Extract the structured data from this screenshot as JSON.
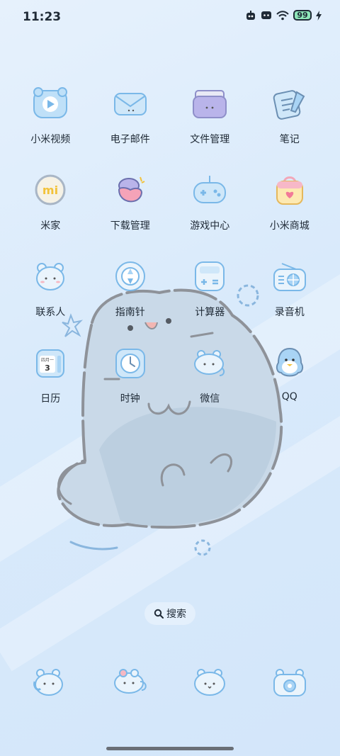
{
  "status_bar": {
    "time": "11:23",
    "battery": "99"
  },
  "apps": [
    [
      {
        "label": "小米视频",
        "icon": "video-icon"
      },
      {
        "label": "电子邮件",
        "icon": "mail-icon"
      },
      {
        "label": "文件管理",
        "icon": "folder-icon"
      },
      {
        "label": "笔记",
        "icon": "notes-icon"
      }
    ],
    [
      {
        "label": "米家",
        "icon": "mijia-icon"
      },
      {
        "label": "下载管理",
        "icon": "download-icon"
      },
      {
        "label": "游戏中心",
        "icon": "gamepad-icon"
      },
      {
        "label": "小米商城",
        "icon": "shop-icon"
      }
    ],
    [
      {
        "label": "联系人",
        "icon": "contacts-icon"
      },
      {
        "label": "指南针",
        "icon": "compass-icon"
      },
      {
        "label": "计算器",
        "icon": "calculator-icon"
      },
      {
        "label": "录音机",
        "icon": "recorder-icon"
      }
    ],
    [
      {
        "label": "日历",
        "icon": "calendar-icon"
      },
      {
        "label": "时钟",
        "icon": "clock-icon"
      },
      {
        "label": "微信",
        "icon": "wechat-icon"
      },
      {
        "label": "QQ",
        "icon": "qq-icon"
      }
    ]
  ],
  "calendar_icon_text": {
    "header": "四月一",
    "day": "3"
  },
  "mijia_icon_text": "mi",
  "search": {
    "label": "搜索"
  },
  "dock": [
    "phone-icon",
    "messages-icon",
    "browser-icon",
    "camera-icon"
  ],
  "colors": {
    "background": "#dbeafb",
    "icon_blue": "#a9d4f5",
    "icon_outline": "#7ab8e8",
    "text": "#1f2a36"
  }
}
